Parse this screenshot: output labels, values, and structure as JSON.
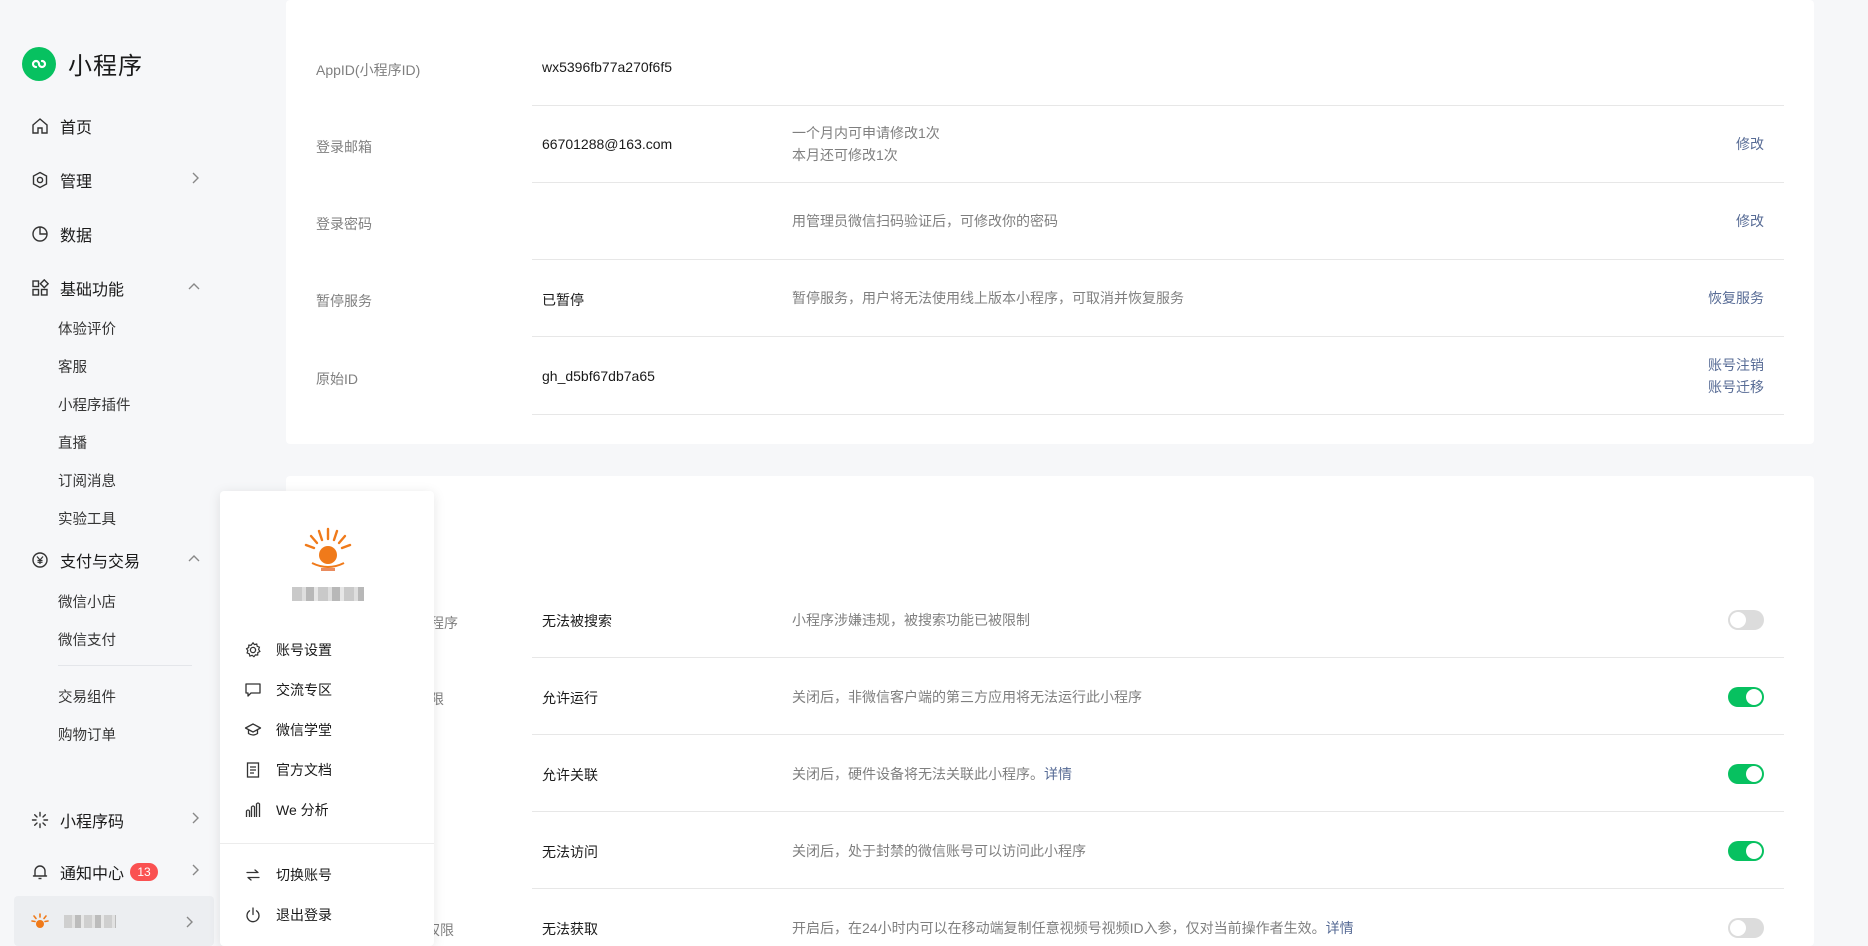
{
  "brand": {
    "title": "小程序"
  },
  "sidebar": {
    "nav": {
      "home": "首页",
      "manage": "管理",
      "data": "数据",
      "basic": "基础功能",
      "pay": "支付与交易",
      "qrcode": "小程序码",
      "notify": "通知中心"
    },
    "basic_items": [
      "体验评价",
      "客服",
      "小程序插件",
      "直播",
      "订阅消息",
      "实验工具"
    ],
    "pay_items": [
      "微信小店",
      "微信支付"
    ],
    "trade_items": [
      "交易组件",
      "购物订单"
    ],
    "notify_badge": "13"
  },
  "info": {
    "rows": [
      {
        "label": "AppID(小程序ID)",
        "value": "wx5396fb77a270f6f5",
        "desc": "",
        "action": ""
      },
      {
        "label": "登录邮箱",
        "value": "66701288@163.com",
        "desc": "一个月内可申请修改1次",
        "desc2": "本月还可修改1次",
        "action": "修改"
      },
      {
        "label": "登录密码",
        "value": "",
        "desc": "用管理员微信扫码验证后，可修改你的密码",
        "action": "修改"
      },
      {
        "label": "暂停服务",
        "value": "已暂停",
        "desc": "暂停服务，用户将无法使用线上版本小程序，可取消并恢复服务",
        "action": "恢复服务"
      },
      {
        "label": "原始ID",
        "value": "gh_d5bf67db7a65",
        "desc": "",
        "action": "账号注销",
        "action2": "账号迁移"
      }
    ]
  },
  "settings": {
    "rows": [
      {
        "label_partial": "程序",
        "value": "无法被搜索",
        "desc": "小程序涉嫌违规，被搜索功能已被限制",
        "link": "",
        "toggle": "off"
      },
      {
        "label_partial": "限",
        "value": "允许运行",
        "desc": "关闭后，非微信客户端的第三方应用将无法运行此小程序",
        "link": "",
        "toggle": "on"
      },
      {
        "label_partial": "",
        "value": "允许关联",
        "desc": "关闭后，硬件设备将无法关联此小程序。",
        "link": "详情",
        "toggle": "on"
      },
      {
        "label_partial": "",
        "value": "无法访问",
        "desc": "关闭后，处于封禁的微信账号可以访问此小程序",
        "link": "",
        "toggle": "on"
      },
      {
        "label_partial": "权限",
        "value": "无法获取",
        "desc": "开启后，在24小时内可以在移动端复制任意视频号视频ID入参，仅对当前操作者生效。",
        "link": "详情",
        "toggle": "off"
      }
    ]
  },
  "popup": {
    "items": [
      "账号设置",
      "交流专区",
      "微信学堂",
      "官方文档",
      "We 分析"
    ],
    "bottom": [
      "切换账号",
      "退出登录"
    ]
  },
  "colors": {
    "accent": "#07c160",
    "link": "#576b95",
    "badge": "#fa5151"
  }
}
